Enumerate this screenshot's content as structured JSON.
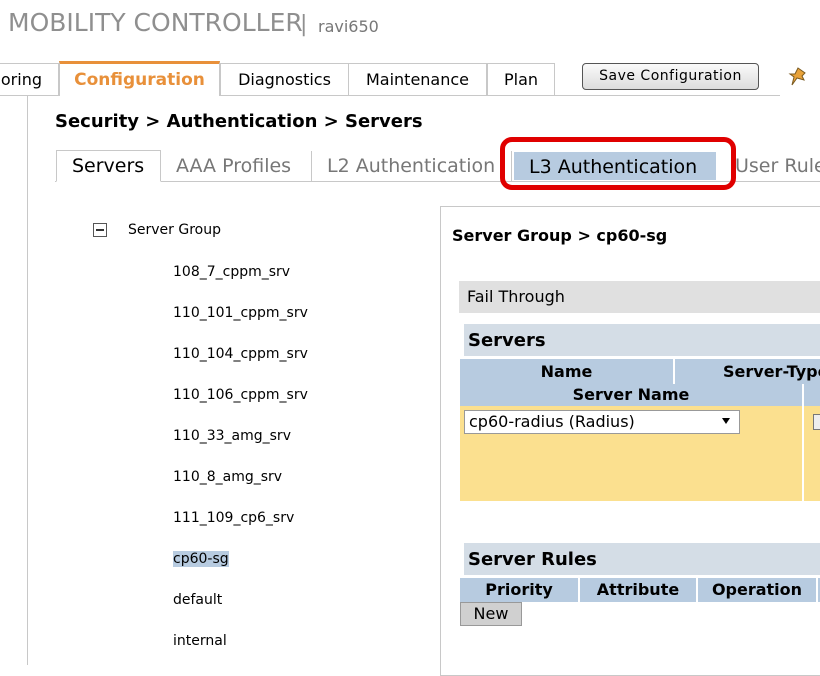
{
  "header": {
    "brand": "MOBILITY CONTROLLER",
    "separator": "|",
    "hostname": "ravi650"
  },
  "nav": {
    "tabs": [
      {
        "label": "oring"
      },
      {
        "label": "Configuration"
      },
      {
        "label": "Diagnostics"
      },
      {
        "label": "Maintenance"
      },
      {
        "label": "Plan"
      }
    ],
    "active": "Configuration",
    "save_label": "Save Configuration"
  },
  "breadcrumb": "Security > Authentication > Servers",
  "sub_tabs": [
    {
      "label": "Servers"
    },
    {
      "label": "AAA Profiles"
    },
    {
      "label": "L2 Authentication"
    },
    {
      "label": "L3 Authentication"
    },
    {
      "label": "User Rule"
    }
  ],
  "tree": {
    "root": "Server Group",
    "items": [
      "108_7_cppm_srv",
      "110_101_cppm_srv",
      "110_104_cppm_srv",
      "110_106_cppm_srv",
      "110_33_amg_srv",
      "110_8_amg_srv",
      "111_109_cp6_srv",
      "cp60-sg",
      "default",
      "internal"
    ],
    "selected": "cp60-sg"
  },
  "panel": {
    "title": "Server Group > cp60-sg",
    "fail_through": "Fail Through",
    "servers": {
      "heading": "Servers",
      "col_name": "Name",
      "col_type": "Server-Type",
      "sub_col": "Server Name",
      "selected_server": "cp60-radius (Radius)"
    },
    "rules": {
      "heading": "Server Rules",
      "col_priority": "Priority",
      "col_attribute": "Attribute",
      "col_operation": "Operation",
      "new_label": "New"
    }
  },
  "colors": {
    "accent": "#e8903a",
    "highlight": "#b7cbe0",
    "callout": "#e00000",
    "row_fill": "#fbe08f"
  }
}
